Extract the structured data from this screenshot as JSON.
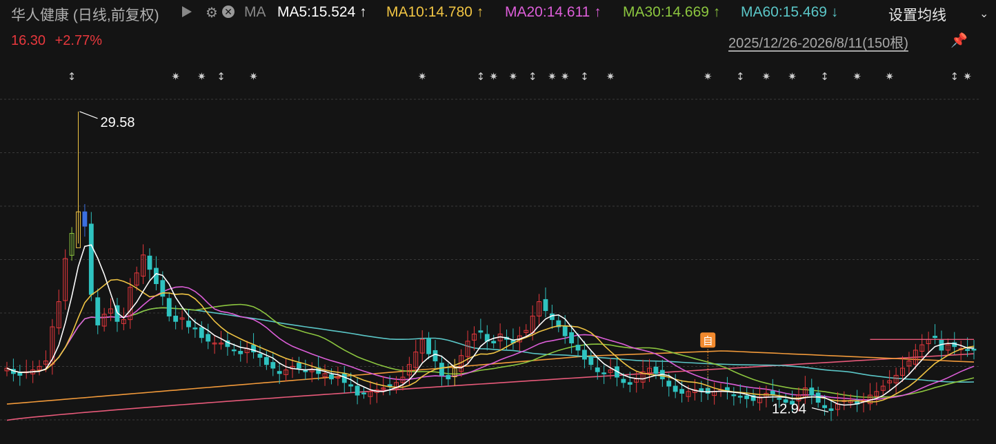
{
  "header": {
    "title": "华人健康 (日线,前复权)",
    "ma_label": "MA",
    "ma_items": [
      {
        "text": "MA5:15.524 ↑",
        "color": "#ffffff"
      },
      {
        "text": "MA10:14.780 ↑",
        "color": "#f0c443"
      },
      {
        "text": "MA20:14.611 ↑",
        "color": "#dd5ed9"
      },
      {
        "text": "MA30:14.669 ↑",
        "color": "#8cc63f"
      },
      {
        "text": "MA60:15.469 ↓",
        "color": "#5bc7c8"
      }
    ],
    "settings_label": "设置均线",
    "price": "16.30",
    "change": "+2.77%",
    "date_range": "2025/12/26-2026/8/11(150根)"
  },
  "chart_data": {
    "type": "candlestick",
    "y_range": [
      12.0,
      30.8
    ],
    "candle_count": 150,
    "annotations": [
      {
        "label": "29.58",
        "type": "high",
        "index": 11,
        "value": 29.58
      },
      {
        "label": "12.94",
        "type": "low",
        "index": 127,
        "value": 12.94
      },
      {
        "label": "自",
        "type": "marker",
        "index": 108,
        "value": 16.9
      }
    ],
    "colors": {
      "up": "#e8383d",
      "down": "#2fc3c0",
      "grid": "#3a3a3a",
      "highlight_up": "#f0c443",
      "highlight_down": "#3b6fe0",
      "highlight_green": "#8cc63f",
      "ma5": "#ffffff",
      "ma10": "#f0c443",
      "ma20": "#dd5ed9",
      "ma30": "#8cc63f",
      "ma60": "#5bc7c8",
      "ma120": "#f29a3a",
      "ma250": "#e85a7a"
    },
    "ma120_tail": 16.6,
    "ma250_tail": 16.1,
    "closes": [
      15.3,
      15.0,
      14.9,
      15.1,
      15.2,
      15.4,
      15.7,
      17.6,
      19.0,
      21.4,
      22.8,
      24.0,
      23.2,
      19.4,
      17.7,
      18.3,
      18.6,
      17.9,
      18.0,
      19.8,
      20.6,
      21.6,
      20.8,
      20.0,
      19.3,
      18.2,
      17.9,
      18.1,
      17.6,
      17.5,
      17.0,
      16.8,
      16.7,
      16.7,
      16.5,
      16.3,
      16.1,
      16.4,
      16.2,
      15.9,
      15.5,
      15.3,
      15.0,
      15.2,
      15.4,
      15.3,
      15.1,
      15.2,
      15.0,
      15.0,
      14.7,
      14.8,
      14.5,
      14.3,
      13.8,
      13.9,
      14.0,
      14.1,
      14.2,
      14.3,
      14.5,
      14.8,
      15.5,
      16.2,
      16.9,
      16.1,
      15.7,
      14.9,
      14.7,
      15.3,
      16.0,
      16.8,
      17.2,
      17.3,
      16.8,
      16.7,
      17.2,
      16.9,
      16.7,
      17.1,
      17.4,
      18.2,
      19.0,
      18.5,
      18.0,
      17.6,
      17.1,
      16.7,
      16.3,
      15.8,
      15.5,
      15.1,
      15.0,
      15.2,
      14.8,
      14.5,
      14.4,
      14.7,
      15.1,
      15.3,
      15.0,
      14.7,
      14.3,
      14.0,
      13.9,
      14.0,
      14.1,
      14.0,
      13.9,
      14.0,
      14.1,
      14.0,
      13.8,
      13.7,
      13.6,
      13.5,
      13.7,
      13.9,
      13.8,
      13.6,
      13.4,
      13.3,
      13.8,
      14.2,
      13.8,
      13.4,
      13.1,
      12.94,
      13.3,
      13.5,
      13.5,
      13.3,
      13.5,
      13.8,
      14.0,
      14.3,
      14.6,
      14.9,
      15.3,
      15.7,
      16.3,
      16.6,
      16.9,
      17.0,
      16.3,
      16.6,
      16.5,
      16.4,
      16.3,
      16.3
    ]
  }
}
